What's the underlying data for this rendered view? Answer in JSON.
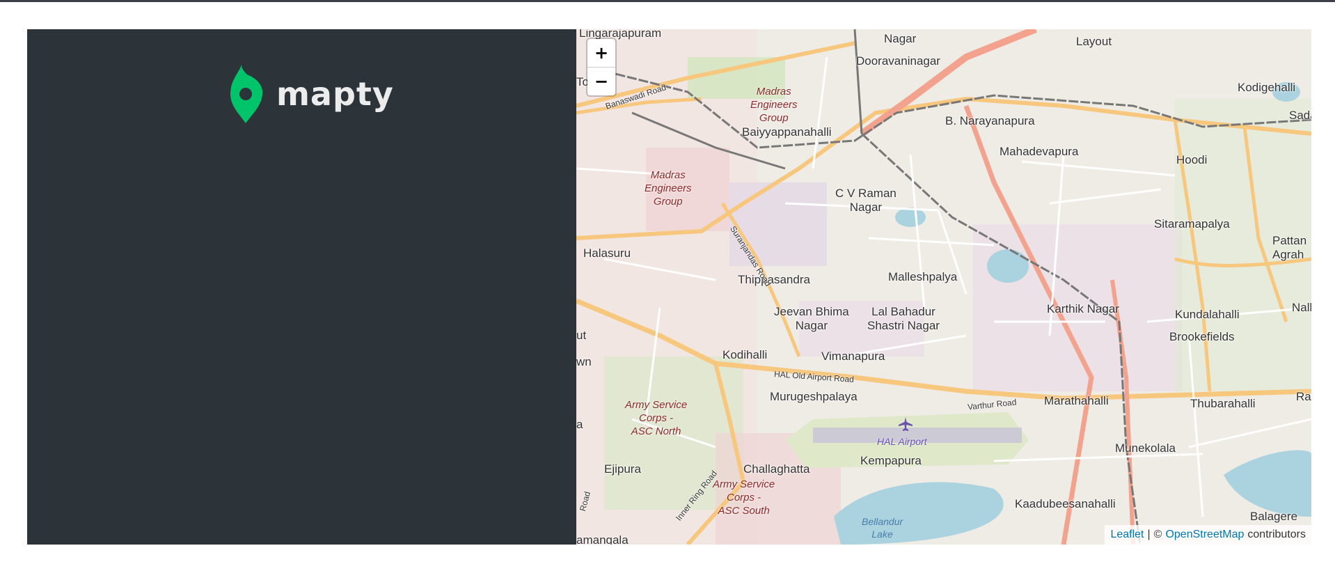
{
  "app": {
    "brand": "mapty",
    "brand_color": "#00c46a",
    "sidebar_color": "#2d3439"
  },
  "map": {
    "zoom_in_label": "+",
    "zoom_out_label": "−",
    "attribution": {
      "leaflet": "Leaflet",
      "separator": "|",
      "copyright": "©",
      "osm": "OpenStreetMap",
      "contributors": "contributors"
    },
    "places": [
      "Lingarajapuram",
      "Nagar",
      "Layout",
      "Dooravaninagar",
      "Kodigehalli",
      "Sada",
      "Baiyyappanahalli",
      "B. Narayanapura",
      "Mahadevapura",
      "Hoodi",
      "C V Raman\nNagar",
      "Sitaramapalya",
      "Pattan\nAgrah",
      "Halasuru",
      "Thippasandra",
      "Malleshpalya",
      "Jeevan Bhima\nNagar",
      "Lal Bahadur\nShastri Nagar",
      "Karthik Nagar",
      "Nallu",
      "Kundalahalli",
      "Brookefields",
      "Kodihalli",
      "Vimanapura",
      "Murugeshpalaya",
      "Marathahalli",
      "Thubarahalli",
      "Rai",
      "Kempapura",
      "Challaghatta",
      "Ejipura",
      "Munekolala",
      "Kaadubeesanahalli",
      "Balagere",
      "amangala",
      "ut",
      "wn",
      "a",
      "To"
    ],
    "areas": [
      "Madras\nEngineers\nGroup",
      "Madras\nEngineers\nGroup",
      "Army Service\nCorps -\nASC North",
      "Army Service\nCorps -\nASC South"
    ],
    "roads": [
      "Banaswadi Road",
      "Suranjandas Road",
      "HAL Old Airport Road",
      "Varthur Road",
      "Inner Ring Road",
      "Road"
    ],
    "airport": "HAL Airport",
    "lake": "Bellandur\nLake"
  }
}
